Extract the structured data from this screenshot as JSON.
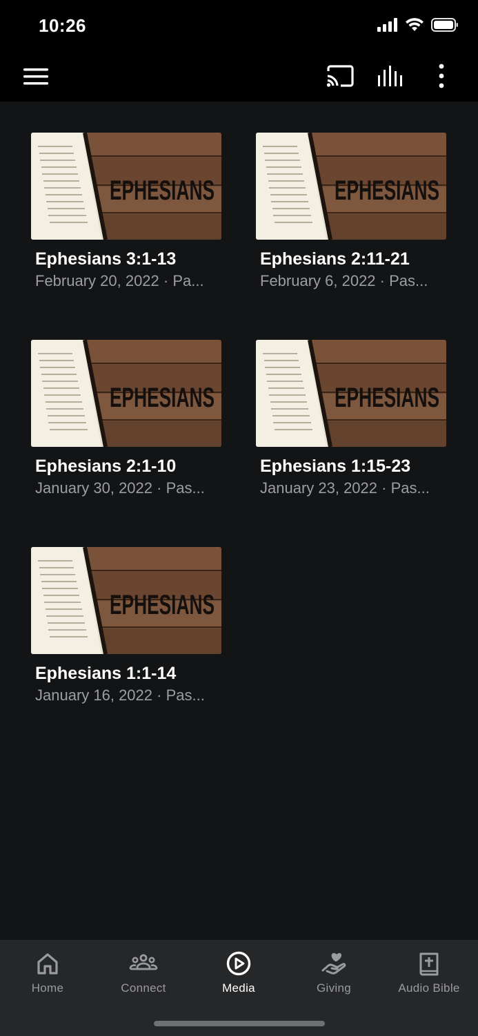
{
  "status": {
    "time": "10:26"
  },
  "header": {
    "menu_icon": "hamburger-menu-icon",
    "cast_icon": "cast-icon",
    "equalizer_icon": "audio-bars-icon",
    "more_icon": "more-vertical-icon"
  },
  "media": {
    "thumbnail_text": "EPHESIANS",
    "items": [
      {
        "title": "Ephesians 3:1-13",
        "subtitle": "February 20, 2022 · Pa..."
      },
      {
        "title": "Ephesians 2:11-21",
        "subtitle": "February 6, 2022 · Pas..."
      },
      {
        "title": "Ephesians 2:1-10",
        "subtitle": "January 30, 2022 · Pas..."
      },
      {
        "title": "Ephesians 1:15-23",
        "subtitle": "January 23, 2022 · Pas..."
      },
      {
        "title": "Ephesians 1:1-14",
        "subtitle": "January 16, 2022 · Pas..."
      }
    ]
  },
  "tabs": [
    {
      "label": "Home",
      "icon": "home-icon",
      "active": false
    },
    {
      "label": "Connect",
      "icon": "people-icon",
      "active": false
    },
    {
      "label": "Media",
      "icon": "play-circle-icon",
      "active": true
    },
    {
      "label": "Giving",
      "icon": "giving-hand-heart-icon",
      "active": false
    },
    {
      "label": "Audio Bible",
      "icon": "bible-icon",
      "active": false
    }
  ],
  "colors": {
    "background": "#131416",
    "bar": "#000000",
    "tab_bar": "#262729",
    "muted_text": "#9d9ea2",
    "active_tab": "#ffffff"
  }
}
